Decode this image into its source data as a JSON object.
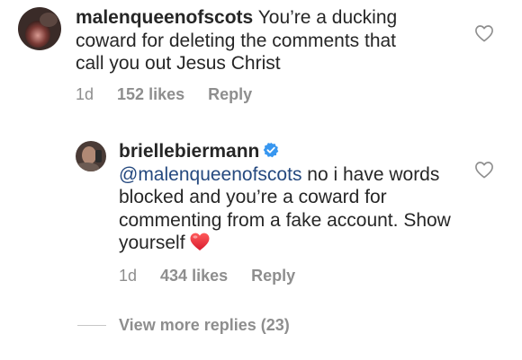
{
  "comments": [
    {
      "username": "malenqueenofscots",
      "text": "You’re a ducking coward for deleting the comments that call you out Jesus Christ",
      "time": "1d",
      "likes": "152 likes",
      "reply": "Reply"
    }
  ],
  "reply": {
    "username": "briellebiermann",
    "verified": true,
    "mention": "@malenqueenofscots",
    "text": "no i have words blocked and you’re a coward for commenting from a fake account. Show yourself",
    "emoji": "red-heart",
    "time": "1d",
    "likes": "434 likes",
    "reply": "Reply"
  },
  "view_more": "View more replies (23)",
  "icons": {
    "like": "heart-outline-icon",
    "verified": "verified-badge-icon"
  },
  "colors": {
    "text": "#262626",
    "secondary": "#8e8e8e",
    "mention": "#25497f",
    "verified": "#3897f0",
    "heart": "#e0245e"
  }
}
